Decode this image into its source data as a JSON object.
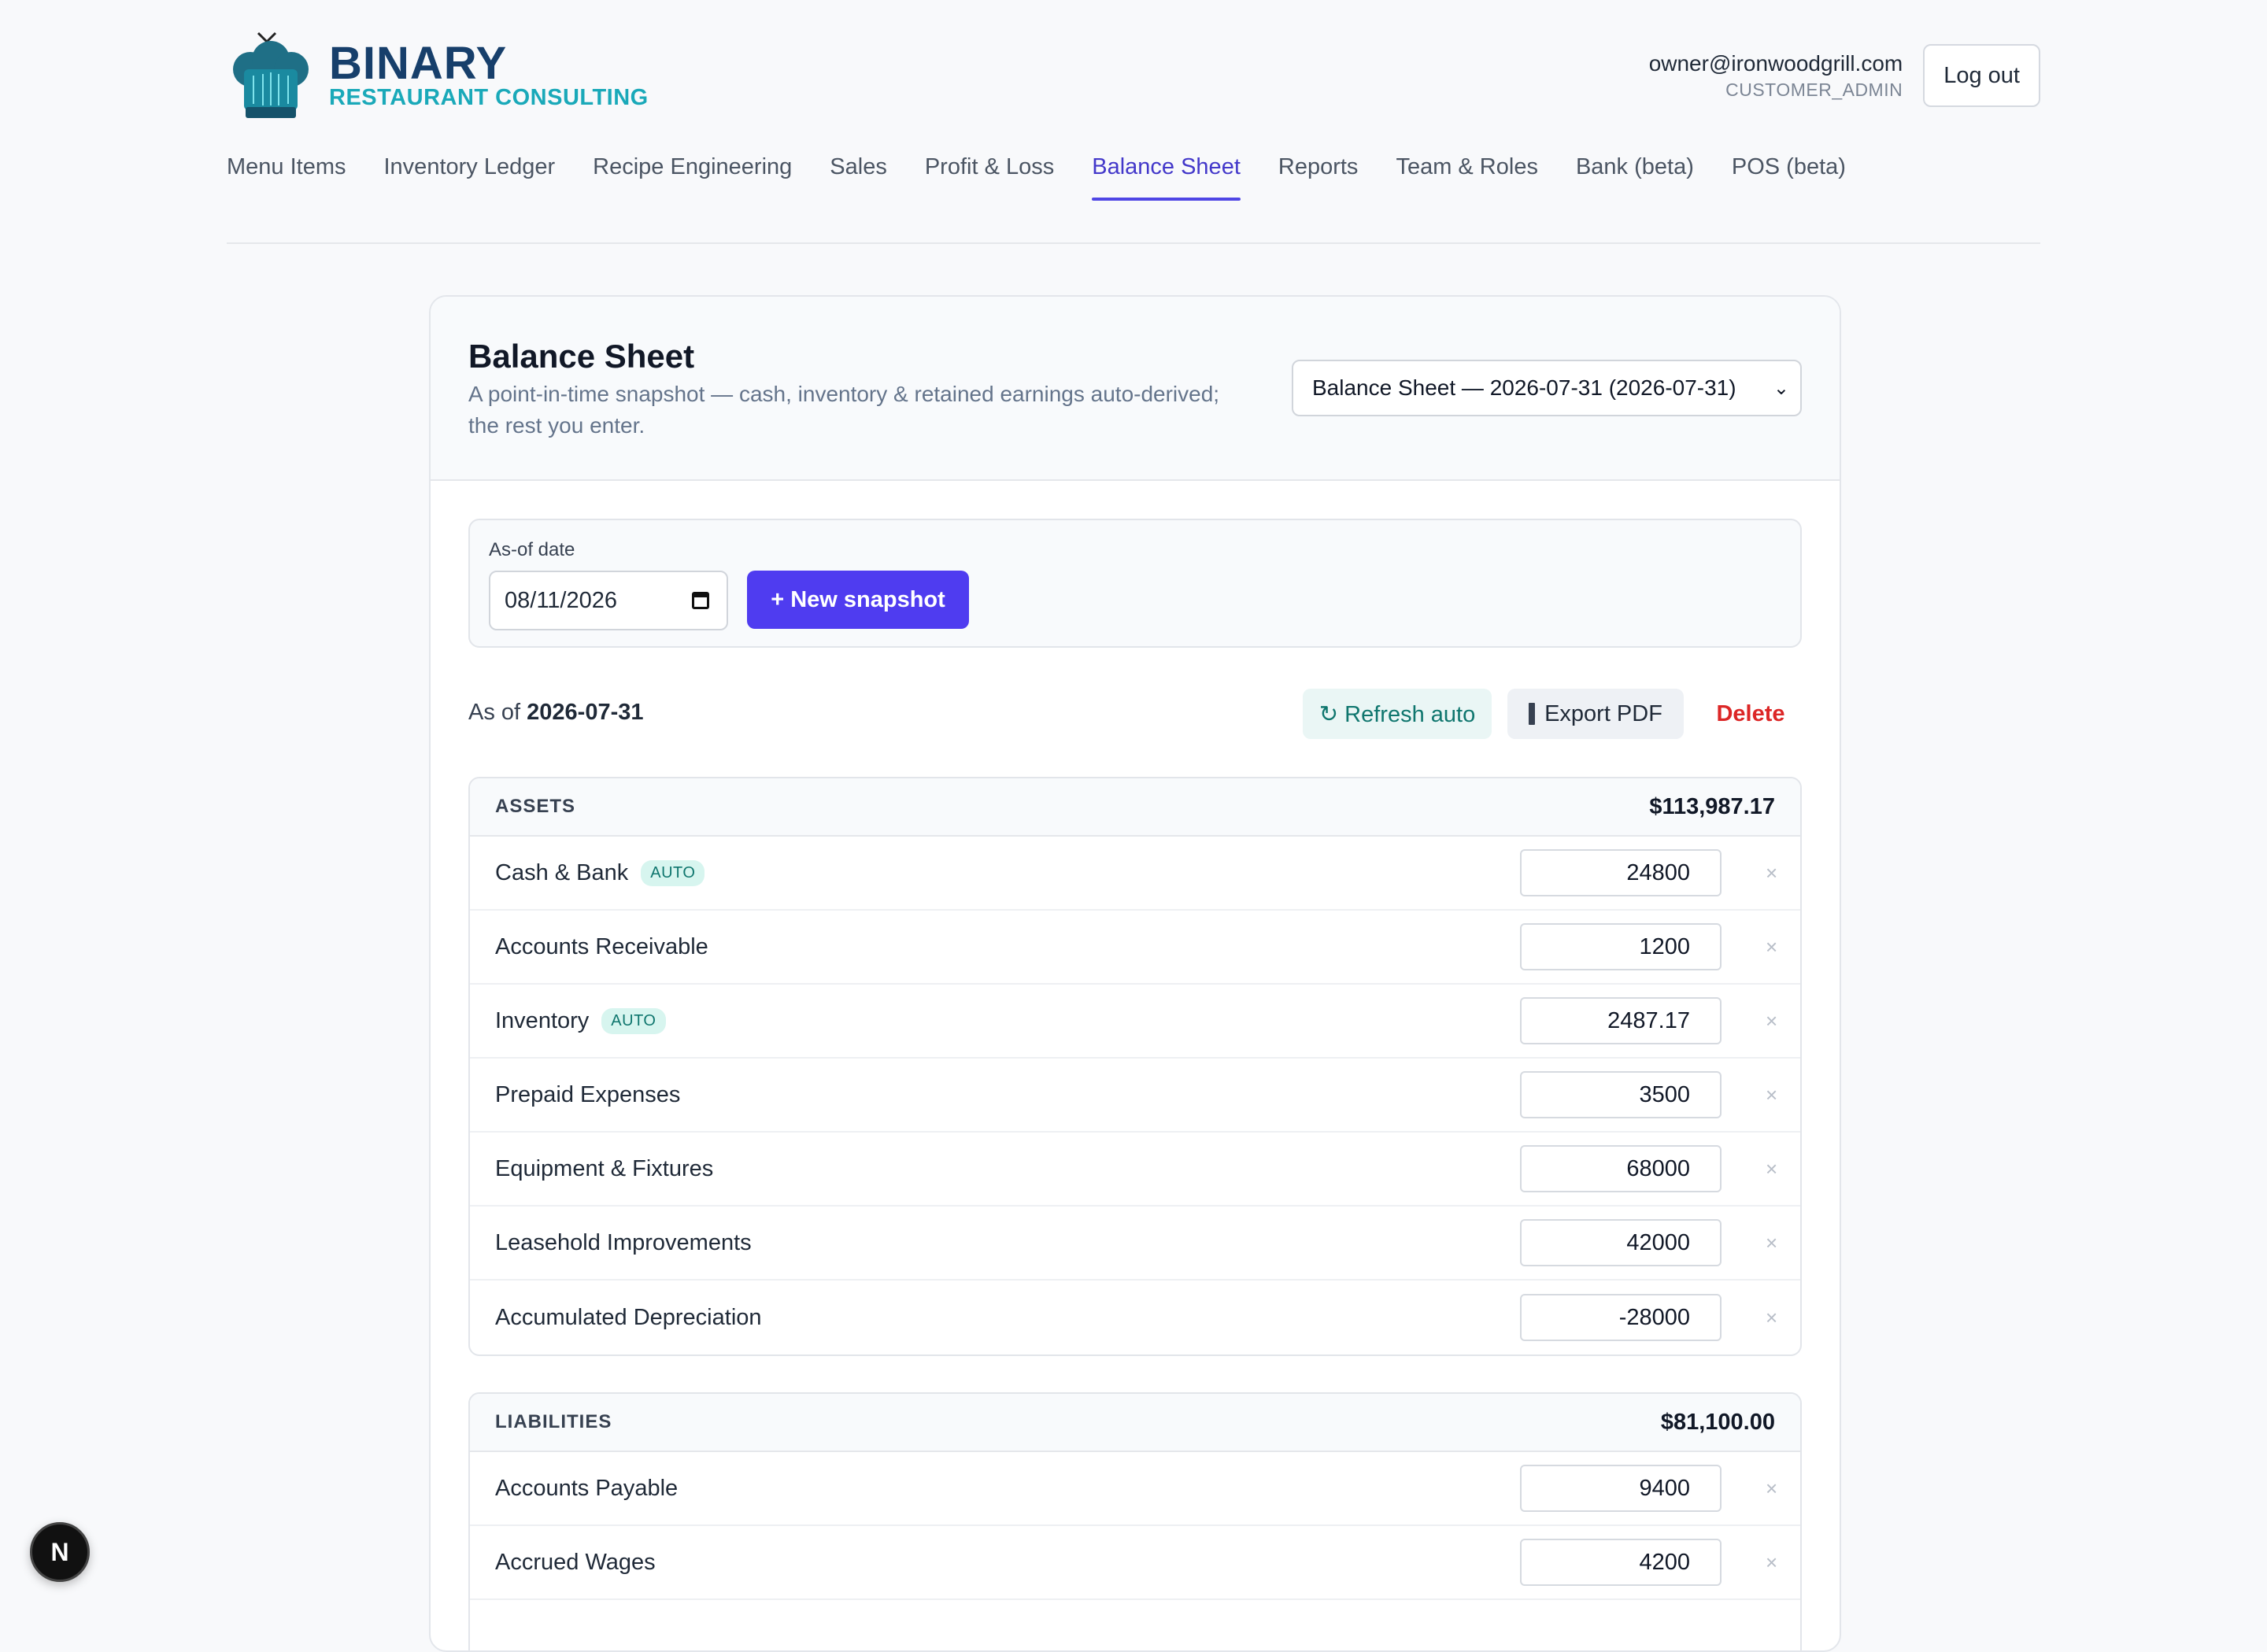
{
  "brand": {
    "name": "BINARY",
    "subtitle": "RESTAURANT CONSULTING"
  },
  "user": {
    "email": "owner@ironwoodgrill.com",
    "role": "CUSTOMER_ADMIN",
    "logout_label": "Log out"
  },
  "nav": {
    "items": [
      {
        "label": "Menu Items"
      },
      {
        "label": "Inventory Ledger"
      },
      {
        "label": "Recipe Engineering"
      },
      {
        "label": "Sales"
      },
      {
        "label": "Profit & Loss"
      },
      {
        "label": "Balance Sheet"
      },
      {
        "label": "Reports"
      },
      {
        "label": "Team & Roles"
      },
      {
        "label": "Bank (beta)"
      },
      {
        "label": "POS (beta)"
      }
    ],
    "active": "Balance Sheet"
  },
  "page": {
    "title": "Balance Sheet",
    "description": "A point-in-time snapshot — cash, inventory & retained earnings auto-derived; the rest you enter.",
    "snapshot_select": "Balance Sheet — 2026-07-31 (2026-07-31)"
  },
  "new_snapshot": {
    "date_label": "As-of date",
    "date_value": "08/11/2026",
    "button_label": "+ New snapshot"
  },
  "snapshot": {
    "asof_prefix": "As of",
    "asof_date": "2026-07-31",
    "refresh_label": "↻ Refresh auto",
    "export_label": "Export PDF",
    "delete_label": "Delete"
  },
  "assets": {
    "label": "ASSETS",
    "total": "$113,987.17",
    "rows": [
      {
        "label": "Cash & Bank",
        "badge": "AUTO",
        "value": "24800"
      },
      {
        "label": "Accounts Receivable",
        "value": "1200"
      },
      {
        "label": "Inventory",
        "badge": "AUTO",
        "value": "2487.17"
      },
      {
        "label": "Prepaid Expenses",
        "value": "3500"
      },
      {
        "label": "Equipment & Fixtures",
        "value": "68000"
      },
      {
        "label": "Leasehold Improvements",
        "value": "42000"
      },
      {
        "label": "Accumulated Depreciation",
        "value": "-28000"
      }
    ]
  },
  "liabilities": {
    "label": "LIABILITIES",
    "total": "$81,100.00",
    "rows": [
      {
        "label": "Accounts Payable",
        "value": "9400"
      },
      {
        "label": "Accrued Wages",
        "value": "4200"
      }
    ]
  },
  "remove_glyph": "×",
  "fab_label": "N",
  "colors": {
    "accent": "#4f3cf0",
    "nav_active": "#4338ca",
    "brand_navy": "#173f6b",
    "brand_teal": "#1aa9b9",
    "danger": "#dc2626",
    "auto_badge": "#0f766e"
  }
}
